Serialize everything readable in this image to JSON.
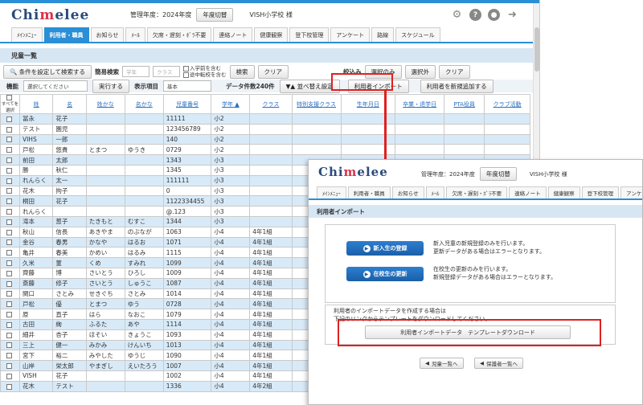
{
  "header": {
    "logo_pre": "Chi",
    "logo_mid": "m",
    "logo_post": "elee",
    "fiscal_year": "管理年度：2024年度",
    "switch_year_button": "年度切替",
    "school_name": "VISH小学校 様"
  },
  "nav": {
    "tabs": [
      "ﾒｲﾝﾒﾆｭｰ",
      "利用者・職員",
      "お知らせ",
      "ﾒｰﾙ",
      "欠席・遅刻・ﾎﾞﾗ不要",
      "連絡ノート",
      "健康観察",
      "登下校管理",
      "アンケート",
      "路線",
      "スケジュール"
    ],
    "active_index": 1
  },
  "page": {
    "title": "児童一覧"
  },
  "filters": {
    "condition_search_button": "条件を設定して検索する",
    "simple_search_label": "簡易検索",
    "grade_placeholder": "学年",
    "class_placeholder": "クラス",
    "include_before_admission": "入学前を含む",
    "include_transferred": "途中転校を含む",
    "search_button": "検索",
    "clear_button": "クリア",
    "narrow_label": "絞込み",
    "selected_only_button": "選択のみ",
    "excluded_button": "選択外",
    "narrow_clear_button": "クリア"
  },
  "toolbar": {
    "function_label": "機能",
    "function_placeholder": "選択してください",
    "execute_button": "実行する",
    "display_label": "表示項目",
    "display_value": "基本",
    "data_count": "データ件数240件",
    "sort_button": "▼▲ 並べ替え設定",
    "import_button": "利用者インポート",
    "add_user_button": "利用者を新規追加する"
  },
  "table": {
    "select_all": "すべてを選択",
    "columns": [
      "姓",
      "名",
      "姓かな",
      "名かな",
      "児童番号",
      "学年 ▲",
      "クラス",
      "特別支援クラス",
      "生年月日",
      "卒業・退学日",
      "PTA役員",
      "クラブ活動"
    ],
    "rows": [
      [
        "冨永",
        "花子",
        "",
        "",
        "11111",
        "小2",
        "",
        "",
        "",
        "",
        "",
        ""
      ],
      [
        "テスト",
        "園児",
        "",
        "",
        "123456789",
        "小2",
        "",
        "",
        "",
        "",
        "",
        ""
      ],
      [
        "VIHS",
        "一郎",
        "",
        "",
        "140",
        "小2",
        "",
        "",
        "",
        "",
        "",
        ""
      ],
      [
        "戸松",
        "悠貴",
        "とまつ",
        "ゆうき",
        "0729",
        "小2",
        "",
        "",
        "",
        "",
        "",
        ""
      ],
      [
        "前田",
        "太郎",
        "",
        "",
        "1343",
        "小3",
        "",
        "",
        "",
        "",
        "",
        ""
      ],
      [
        "勝",
        "秋仁",
        "",
        "",
        "1345",
        "小3",
        "",
        "",
        "",
        "",
        "",
        ""
      ],
      [
        "れんらく",
        "太一",
        "",
        "",
        "111111",
        "小3",
        "",
        "",
        "",
        "",
        "",
        ""
      ],
      [
        "花木",
        "拘子",
        "",
        "",
        "0",
        "小3",
        "",
        "",
        "",
        "",
        "",
        ""
      ],
      [
        "桐田",
        "花子",
        "",
        "",
        "1122334455",
        "小3",
        "",
        "",
        "",
        "",
        "",
        ""
      ],
      [
        "れんらく",
        "",
        "",
        "",
        "@.123",
        "小3",
        "",
        "",
        "",
        "",
        "",
        ""
      ],
      [
        "滝本",
        "葱子",
        "たきもと",
        "むすこ",
        "1344",
        "小3",
        "",
        "",
        "",
        "",
        "",
        ""
      ],
      [
        "秋山",
        "信長",
        "あきやま",
        "のぶなが",
        "1063",
        "小4",
        "4年1組",
        "",
        "",
        "",
        "",
        ""
      ],
      [
        "金谷",
        "春男",
        "かなや",
        "はるお",
        "1071",
        "小4",
        "4年1組",
        "",
        "",
        "",
        "",
        ""
      ],
      [
        "亀井",
        "春美",
        "かめい",
        "はるみ",
        "1115",
        "小4",
        "4年1組",
        "",
        "",
        "",
        "",
        ""
      ],
      [
        "久米",
        "菫",
        "くめ",
        "すみれ",
        "1099",
        "小4",
        "4年1組",
        "",
        "",
        "",
        "",
        ""
      ],
      [
        "齊藤",
        "博",
        "さいとう",
        "ひろし",
        "1009",
        "小4",
        "4年1組",
        "",
        "",
        "",
        "",
        ""
      ],
      [
        "斎藤",
        "修子",
        "さいとう",
        "しゅうこ",
        "1087",
        "小4",
        "4年1組",
        "",
        "",
        "",
        "",
        ""
      ],
      [
        "関口",
        "さとみ",
        "せきぐち",
        "さとみ",
        "1014",
        "小4",
        "4年1組",
        "",
        "",
        "",
        "",
        ""
      ],
      [
        "戸松",
        "優",
        "とまつ",
        "ゆう",
        "0728",
        "小4",
        "4年1組",
        "",
        "",
        "",
        "",
        ""
      ],
      [
        "原",
        "直子",
        "はら",
        "なおこ",
        "1079",
        "小4",
        "4年1組",
        "",
        "",
        "",
        "",
        ""
      ],
      [
        "古田",
        "絢",
        "ふるた",
        "あや",
        "1114",
        "小4",
        "4年1組",
        "",
        "",
        "",
        "",
        ""
      ],
      [
        "細井",
        "杏子",
        "ほそい",
        "きょうこ",
        "1093",
        "小4",
        "4年1組",
        "",
        "",
        "",
        "",
        ""
      ],
      [
        "三上",
        "健一",
        "みかみ",
        "けんいち",
        "1013",
        "小4",
        "4年1組",
        "",
        "",
        "",
        "",
        ""
      ],
      [
        "宮下",
        "裕二",
        "みやした",
        "ゆうじ",
        "1090",
        "小4",
        "4年1組",
        "",
        "",
        "",
        "",
        ""
      ],
      [
        "山岸",
        "栄太郎",
        "やまぎし",
        "えいたろう",
        "1007",
        "小4",
        "4年1組",
        "",
        "",
        "",
        "",
        ""
      ],
      [
        "VISH",
        "花子",
        "",
        "",
        "1002",
        "小4",
        "4年1組",
        "",
        "",
        "",
        "",
        ""
      ],
      [
        "花木",
        "テスト",
        "",
        "",
        "1336",
        "小4",
        "4年2組",
        "",
        "",
        "",
        "",
        ""
      ]
    ]
  },
  "popup": {
    "fiscal_year": "管理年度：2024年度",
    "switch_year_button": "年度切替",
    "school_name": "VISH小学校 様",
    "tabs": [
      "ﾒｲﾝﾒﾆｭｰ",
      "利用者・職員",
      "お知らせ",
      "ﾒｰﾙ",
      "欠席・遅刻・ﾎﾞﾗ不要",
      "連絡ノート",
      "健康観察",
      "登下校管理",
      "アンケート"
    ],
    "title": "利用者インポート",
    "new_register_button": "新入生の登録",
    "new_register_desc1": "新入児童の新規登録のみを行います。",
    "new_register_desc2": "更新データがある場合はエラーとなります。",
    "update_button": "在校生の更新",
    "update_desc1": "在校生の更新のみを行います。",
    "update_desc2": "新規登録データがある場合はエラーとなります。",
    "note1": "利用者のインポートデータを作成する場合は",
    "note2": "下記のリンクからテンプレートをダウンロードしてください。",
    "download_button": "利用者インポートデータ　テンプレートダウンロード",
    "back_children_button": "児童一覧へ",
    "back_guardians_button": "保護者一覧へ"
  },
  "colors": {
    "accent": "#2a8fd6",
    "highlight": "#e02020",
    "row_blue": "#d8eaf8"
  }
}
